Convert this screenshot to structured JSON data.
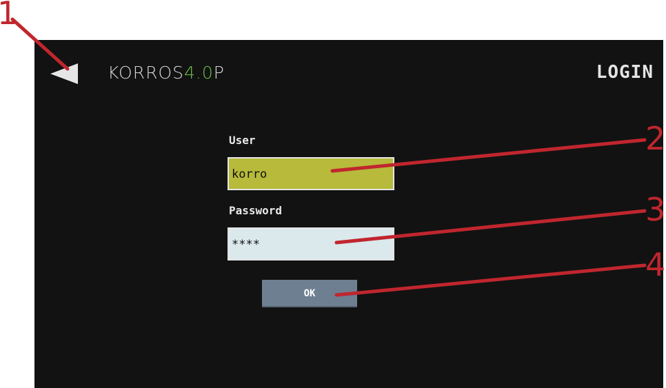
{
  "header": {
    "logo": {
      "text_main": "KORROS",
      "text_accent": "4.0",
      "text_suffix": "P"
    },
    "title": "LOGIN"
  },
  "form": {
    "user_label": "User",
    "user_value": "korro",
    "password_label": "Password",
    "password_value": "****",
    "ok_label": "OK"
  },
  "callouts": [
    "1",
    "2",
    "3",
    "4"
  ],
  "colors": {
    "callout": "#c0262e",
    "screen_bg": "#121212",
    "user_field": "#b7ba3a",
    "password_field": "#dbe8ec",
    "ok_button": "#6e7f91",
    "logo_accent": "#6cc04a"
  },
  "icons": {
    "back": "back-arrow-icon"
  }
}
